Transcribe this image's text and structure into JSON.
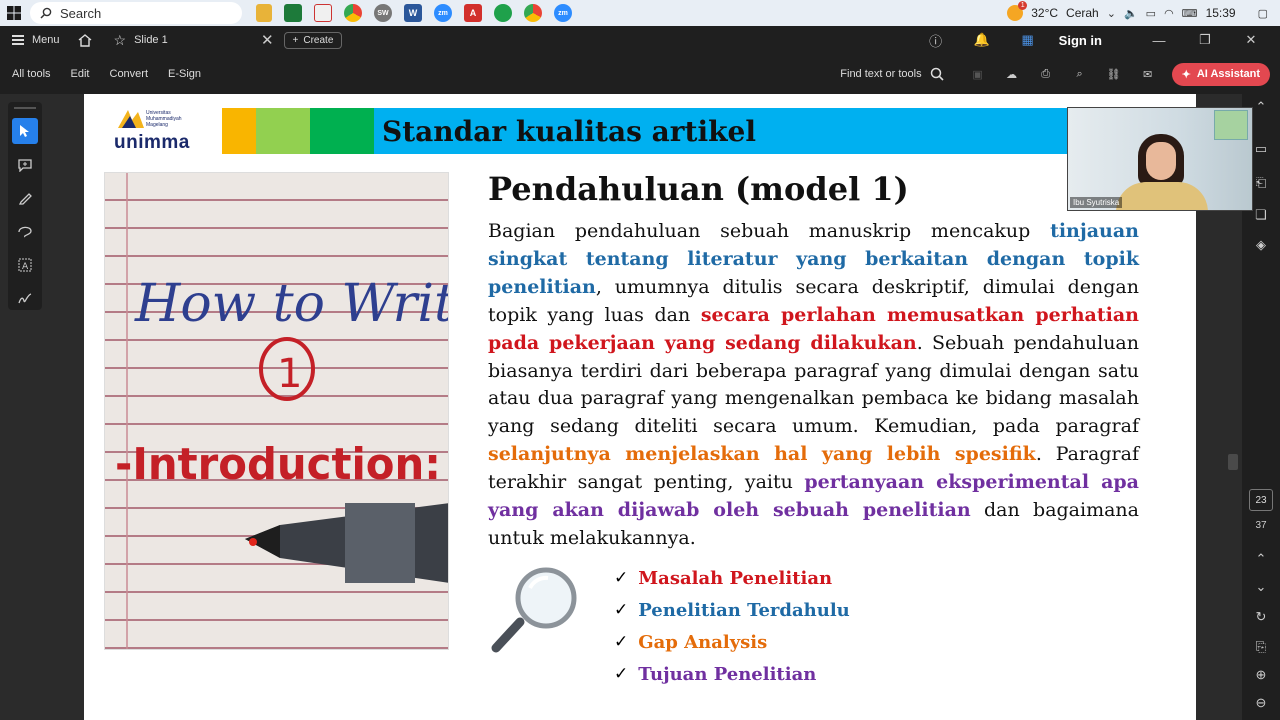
{
  "taskbar": {
    "search_label": "Search",
    "temperature": "32°C",
    "weather": "Cerah",
    "time": "15:39"
  },
  "titlebar": {
    "menu_label": "Menu",
    "tab_title": "Slide 1",
    "create_label": "Create",
    "sign_in_label": "Sign in"
  },
  "toolbar": {
    "tabs": [
      "All tools",
      "Edit",
      "Convert",
      "E-Sign"
    ],
    "find_label": "Find text or tools",
    "ai_assistant_label": "AI Assistant"
  },
  "pagination": {
    "current_page": "23",
    "total_pages": "37"
  },
  "slide": {
    "logo_small_text": "Universitas Muhammadiyah Magelang",
    "logo_word": "unimma",
    "title": "Standar kualitas artikel",
    "heading": "Pendahuluan (model 1)",
    "paragraph": {
      "p1": "Bagian pendahuluan sebuah manuskrip mencakup ",
      "h1": "tinjauan singkat tentang literatur yang berkaitan dengan topik penelitian",
      "p2": ", umumnya ditulis secara deskriptif, dimulai dengan topik yang luas dan ",
      "h2": "secara perlahan memusatkan perhatian pada pekerjaan yang sedang dilakukan",
      "p3": ". Sebuah pendahuluan biasanya terdiri dari beberapa paragraf yang dimulai dengan satu atau dua paragraf yang mengenalkan pembaca ke bidang masalah yang sedang diteliti secara umum. Kemudian, pada paragraf ",
      "h3": "selanjutnya menjelaskan hal yang lebih spesifik",
      "p4": ". Paragraf terakhir sangat penting, yaitu ",
      "h4": "pertanyaan eksperimental apa yang akan dijawab oleh sebuah penelitian",
      "p5": " dan bagaimana untuk melakukannya."
    },
    "checklist": [
      {
        "mark": "✓",
        "label": "Masalah Penelitian",
        "color": "#d0161d"
      },
      {
        "mark": "✓",
        "label": "Penelitian Terdahulu",
        "color": "#1f6aa5"
      },
      {
        "mark": "✓",
        "label": "Gap Analysis",
        "color": "#e46c0a"
      },
      {
        "mark": "✓",
        "label": "Tujuan Penelitian",
        "color": "#7030a0"
      }
    ],
    "photo_text": {
      "line1": "How to Write",
      "line2": "1",
      "line3": "-Introduction:"
    }
  },
  "webcam": {
    "participant_name": "Ibu Syutriska"
  },
  "colors": {
    "accent_blue": "#2680eb",
    "ai_red": "#e34850",
    "title_bar_cyan": "#00b0f0"
  }
}
